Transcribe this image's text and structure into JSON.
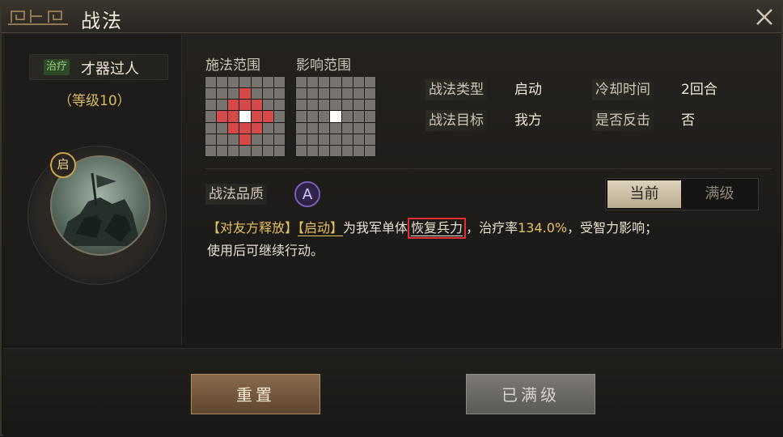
{
  "window": {
    "title": "战法",
    "close_icon": "close-icon"
  },
  "skill": {
    "type_tag": "治疗",
    "name": "才器过人",
    "level": "（等级10）",
    "badge": "启"
  },
  "ranges": {
    "cast_label": "施法范围",
    "effect_label": "影响范围"
  },
  "info": {
    "type_label": "战法类型",
    "type_value": "启动",
    "cooldown_label": "冷却时间",
    "cooldown_value": "2回合",
    "target_label": "战法目标",
    "target_value": "我方",
    "counter_label": "是否反击",
    "counter_value": "否"
  },
  "quality": {
    "label": "战法品质",
    "grade": "A"
  },
  "toggle": {
    "current": "当前",
    "max": "满级"
  },
  "description": {
    "tag1": "【对友方释放】",
    "tag2": "【启动】",
    "part1": "为我军单体",
    "highlight": "恢复兵力",
    "part2": "，治疗率",
    "rate": "134.0%",
    "part3": "，受智力影响；",
    "line2": "使用后可继续行动。"
  },
  "buttons": {
    "reset": "重置",
    "maxed": "已满级"
  },
  "colors": {
    "red_cell": "#d34a48",
    "gold_text": "#e6c15c",
    "highlight_box": "#e23030"
  }
}
